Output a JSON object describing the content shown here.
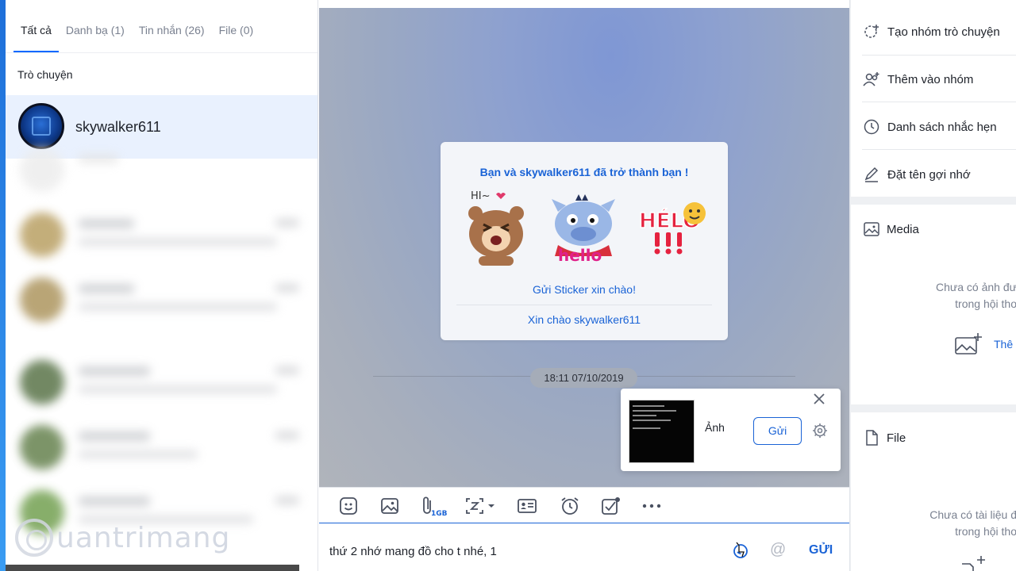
{
  "left_panel": {
    "tabs": [
      {
        "label": "Tất cả"
      },
      {
        "label": "Danh bạ (1)"
      },
      {
        "label": "Tin nhắn (26)"
      },
      {
        "label": "File (0)"
      }
    ],
    "section_title": "Trò chuyện",
    "active_conversation": {
      "name": "skywalker611"
    },
    "watermark": "uantrimang"
  },
  "chat": {
    "greeting": {
      "title": "Bạn và skywalker611 đã trở thành bạn !",
      "sticker_texts": [
        "HI~",
        "hello",
        "HÉLÔ"
      ],
      "send_sticker": "Gửi Sticker xin chào!",
      "say_hello": "Xin chào skywalker611"
    },
    "timestamp": "18:11 07/10/2019",
    "image_popup": {
      "label": "Ảnh",
      "send_label": "Gửi"
    },
    "toolbar": {
      "icons": [
        "sticker-icon",
        "image-icon",
        "attach-icon",
        "screenshot-icon",
        "contact-card-icon",
        "reminder-icon",
        "task-icon",
        "more-icon"
      ],
      "attach_badge": "1GB"
    },
    "input": {
      "value": "thứ 2 nhớ mang đồ cho t nhé, 1"
    },
    "send_label": "GỬI"
  },
  "right_panel": {
    "actions": [
      {
        "label": "Tạo nhóm trò chuyện",
        "icon": "group-add-icon"
      },
      {
        "label": "Thêm vào nhóm",
        "icon": "add-member-icon"
      },
      {
        "label": "Danh sách nhắc hẹn",
        "icon": "clock-icon"
      },
      {
        "label": "Đặt tên gợi nhớ",
        "icon": "pencil-icon"
      }
    ],
    "media": {
      "title": "Media",
      "empty_line1": "Chưa có ảnh đư",
      "empty_line2": "trong hội tho",
      "add_label": "Thê"
    },
    "file": {
      "title": "File",
      "empty_line1": "Chưa có tài liệu đ",
      "empty_line2": "trong hội tho"
    }
  },
  "colors": {
    "accent": "#1a63d6",
    "active_row": "#e9f1fe",
    "panel_bg": "#eef0f3"
  }
}
